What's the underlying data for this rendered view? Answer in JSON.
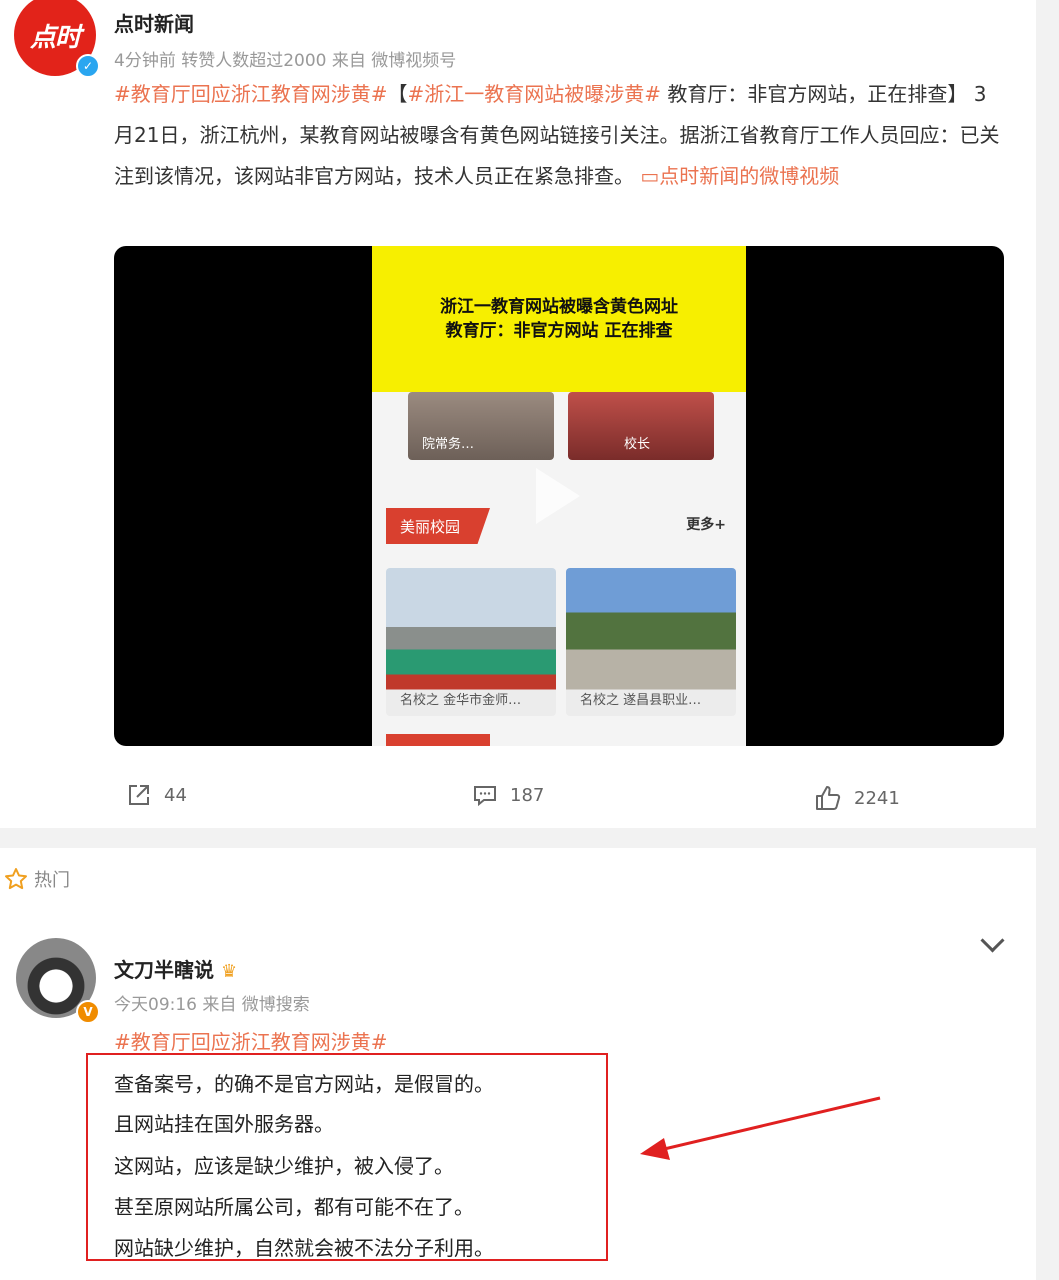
{
  "post": {
    "author": "点时新闻",
    "avatar_text": "点时",
    "meta_time": "4分钟前",
    "meta_repost": "转赞人数超过2000",
    "meta_source": "来自 微博视频号",
    "tag1": "#教育厅回应浙江教育网涉黄#",
    "bracket_open": "【",
    "tag2": "#浙江一教育网站被曝涉黄#",
    "text_a": " 教育厅：非官方网站，正在排查】 3月21日，浙江杭州，某教育网站被曝含有黄色网站链接引关注。据浙江省教育厅工作人员回应：已关注到该情况，该网站非官方网站，技术人员正在紧急排查。",
    "video_link": "点时新闻的微博视频",
    "video": {
      "headline1": "浙江一教育网站被曝含黄色网址",
      "headline2": "教育厅：非官方网站 正在排查",
      "thumb1_cap": "院常务…",
      "thumb2_cap": "校长",
      "section_tag": "美丽校园",
      "more": "更多+",
      "thumb3_cap": "名校之 金华市金师…",
      "thumb4_cap": "名校之 遂昌县职业…"
    },
    "actions": {
      "repost": "44",
      "comment": "187",
      "like": "2241"
    }
  },
  "hot_label": "热门",
  "comment": {
    "author": "文刀半瞎说",
    "meta": "今天09:16  来自 微博搜索",
    "tag": "#教育厅回应浙江教育网涉黄#",
    "lines": [
      "查备案号，的确不是官方网站，是假冒的。",
      "且网站挂在国外服务器。",
      "这网站，应该是缺少维护，被入侵了。",
      "甚至原网站所属公司，都有可能不在了。",
      "网站缺少维护，自然就会被不法分子利用。"
    ]
  },
  "colors": {
    "accent": "#eb7350",
    "highlight_box": "#e02020"
  }
}
